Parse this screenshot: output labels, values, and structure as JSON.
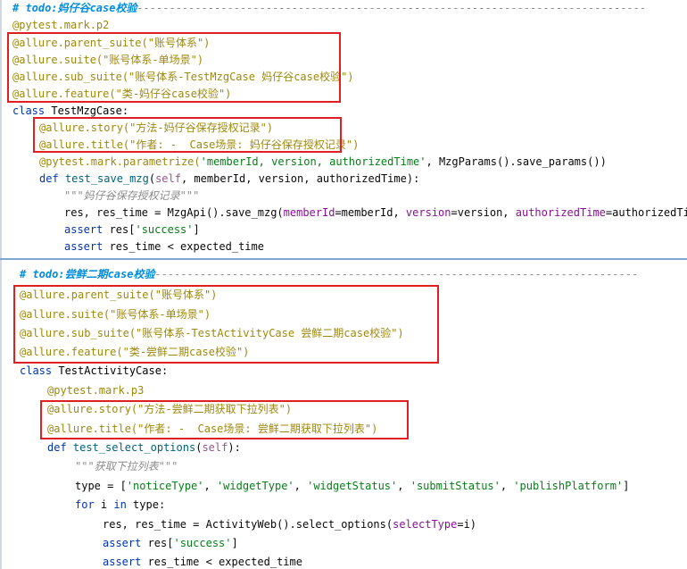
{
  "top": {
    "todo_comment": "# todo:妈仔谷case校验",
    "comment_dashes": "-------------------------------------------------------------------------------",
    "mark": "@pytest.mark.p2",
    "parent_suite": "@allure.parent_suite(\"账号体系\")",
    "suite": "@allure.suite(\"账号体系-单场景\")",
    "sub_suite": "@allure.sub_suite(\"账号体系-TestMzgCase 妈仔谷case校验\")",
    "feature": "@allure.feature(\"类-妈仔谷case校验\")",
    "class_kw": "class",
    "class_name": "TestMzgCase:",
    "story": "@allure.story(\"方法-妈仔谷保存授权记录\")",
    "title": "@allure.title(\"作者: -  Case场景: 妈仔谷保存授权记录\")",
    "parametrize_dec": "@pytest.mark.parametrize(",
    "parametrize_str": "'memberId, version, authorizedTime'",
    "parametrize_rest": ", MzgParams().save_params())",
    "def_kw": "def",
    "func_name": "test_save_mzg",
    "func_open": "(",
    "func_self": "self",
    "func_args": ", memberId, version, authorizedTime):",
    "docstring": "\"\"\"妈仔谷保存授权记录\"\"\"",
    "call_lhs": "res, res_time = MzgApi().save_mzg(",
    "call_kw1": "memberId",
    "call_v1": "=memberId, ",
    "call_kw2": "version",
    "call_v2": "=version, ",
    "call_kw3": "authorizedTime",
    "call_v3": "=authorizedTime)",
    "assert_kw": "assert",
    "assert1_a": " res[",
    "assert1_str": "'success'",
    "assert1_b": "]",
    "assert2": " res_time < expected_time"
  },
  "bottom": {
    "todo_comment": "# todo:尝鲜二期case校验",
    "comment_dashes": "---------------------------------------------------------------------------",
    "parent_suite": "@allure.parent_suite(\"账号体系\")",
    "suite": "@allure.suite(\"账号体系-单场景\")",
    "sub_suite": "@allure.sub_suite(\"账号体系-TestActivityCase 尝鲜二期case校验\")",
    "feature": "@allure.feature(\"类-尝鲜二期case校验\")",
    "class_kw": "class",
    "class_name": "TestActivityCase:",
    "mark": "@pytest.mark.p3",
    "story": "@allure.story(\"方法-尝鲜二期获取下拉列表\")",
    "title": "@allure.title(\"作者: -  Case场景: 尝鲜二期获取下拉列表\")",
    "def_kw": "def",
    "func_name": "test_select_options",
    "func_open": "(",
    "func_self": "self",
    "func_close": "):",
    "docstring": "\"\"\"获取下拉列表\"\"\"",
    "type_lhs": "type = [",
    "type_items": [
      "'noticeType'",
      "'widgetType'",
      "'widgetStatus'",
      "'submitStatus'",
      "'publishPlatform'"
    ],
    "type_sep": ", ",
    "type_close": "]",
    "for_kw": "for",
    "for_mid": " i ",
    "in_kw": "in",
    "for_rest": " type:",
    "call_lhs": "res, res_time = ActivityWeb().select_options(",
    "call_kw": "selectType",
    "call_rest": "=i)",
    "assert_kw": "assert",
    "assert1_a": " res[",
    "assert1_str": "'success'",
    "assert1_b": "]",
    "assert2": " res_time < expected_time"
  }
}
